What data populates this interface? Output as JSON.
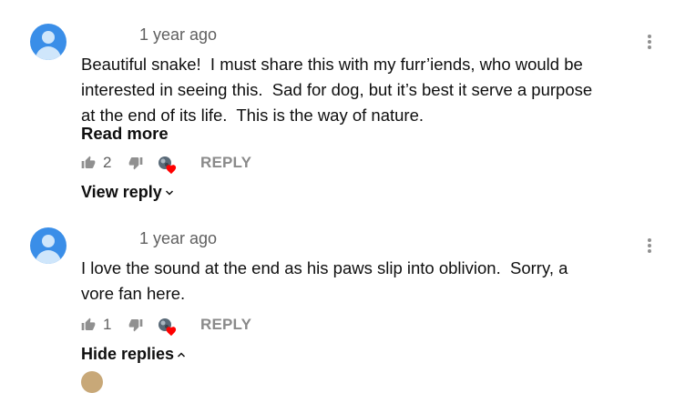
{
  "comments": [
    {
      "time": "1 year ago",
      "text": "Beautiful snake!  I must share this with my furr’iends, who would be\ninterested in seeing this.  Sad for dog, but it’s best it serve a purpose\nat the end of its life.  This is the way of nature.",
      "read_more": "Read more",
      "likes": "2",
      "reply": "REPLY",
      "toggle": "View reply"
    },
    {
      "time": "1 year ago",
      "text": "I love the sound at the end as his paws slip into oblivion.  Sorry, a\nvore fan here.",
      "likes": "1",
      "reply": "REPLY",
      "toggle": "Hide replies"
    }
  ],
  "icons": {
    "menu": "more-vert-icon",
    "like": "thumb-up-icon",
    "dislike": "thumb-down-icon",
    "creator_heart": "creator-heart-icon"
  },
  "colors": {
    "avatar": "#3a8ee8",
    "heart": "#ff0000",
    "secondary_text": "#606060"
  }
}
